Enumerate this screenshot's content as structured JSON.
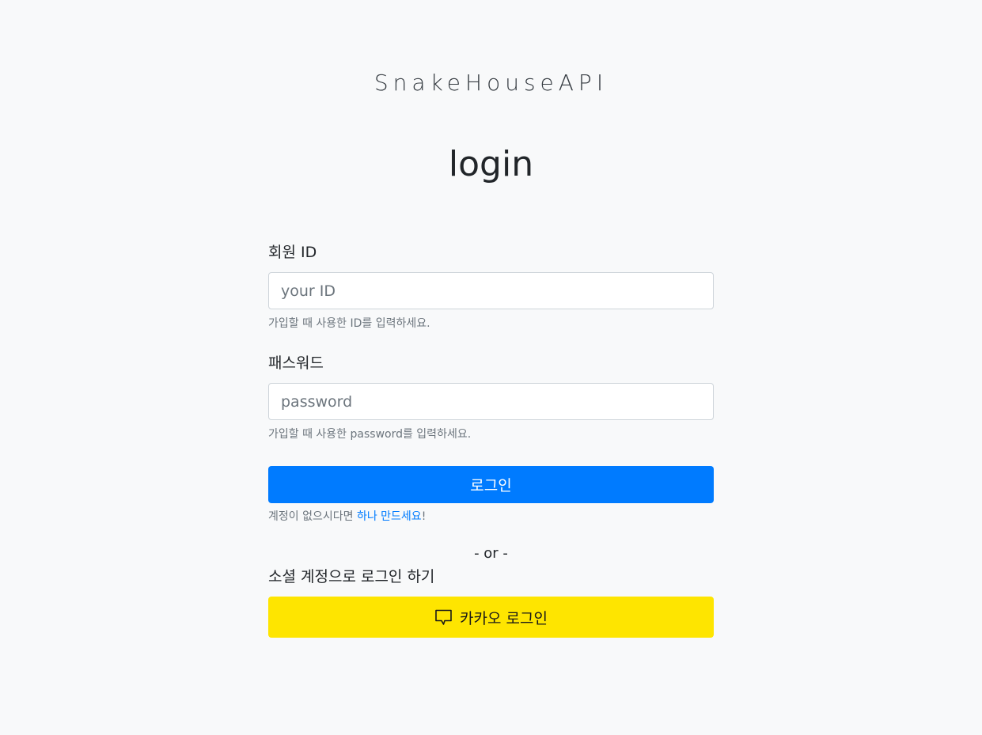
{
  "brand": "SnakeHouseAPI",
  "title": "login",
  "id_field": {
    "label": "회원 ID",
    "placeholder": "your ID",
    "value": "",
    "help": "가입할 때 사용한 ID를 입력하세요."
  },
  "password_field": {
    "label": "패스워드",
    "placeholder": "password",
    "value": "",
    "help": "가입할 때 사용한 password를 입력하세요."
  },
  "login_button": "로그인",
  "signup": {
    "prefix": "계정이 없으시다면 ",
    "link": "하나 만드세요",
    "suffix": "!"
  },
  "divider": "- or -",
  "social": {
    "label": "소셜 계정으로 로그인 하기",
    "kakao_button": "카카오 로그인",
    "kakao_icon": "speech-bubble-icon",
    "kakao_color": "#fee500"
  },
  "colors": {
    "primary": "#007bff",
    "background": "#f8f9fa"
  }
}
